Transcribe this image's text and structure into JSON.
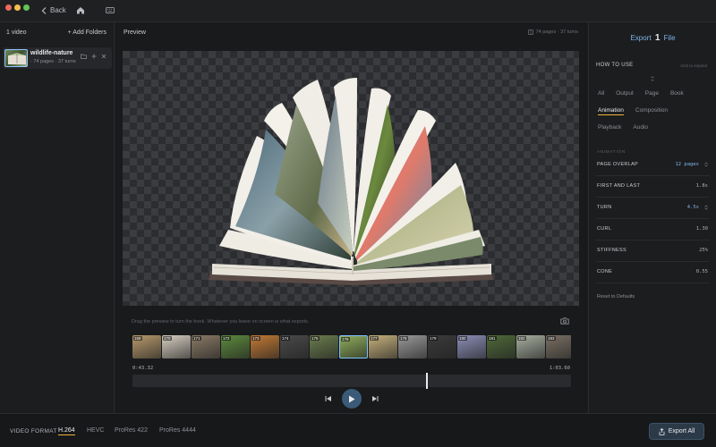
{
  "toolbar": {
    "back_label": "Back"
  },
  "sidebar": {
    "count_label": "1 video",
    "add_folders_label": "+ Add Folders",
    "videos": [
      {
        "name": "wildlife-nature",
        "meta": "· 74 pages · 37 turns"
      }
    ]
  },
  "preview": {
    "label": "Preview",
    "meta": "74 pages · 37 turns",
    "hint": "Drag the preview to turn the book. Whatever you leave on screen is what exports.",
    "start_time": "0:43.32",
    "end_time": "1:03.60",
    "playhead_fraction": 0.67,
    "frames": [
      {
        "num": "169",
        "color": "#b79a6c"
      },
      {
        "num": "170",
        "color": "#d7cfc2"
      },
      {
        "num": "171",
        "color": "#8a7a66"
      },
      {
        "num": "172",
        "color": "#5d8a3e"
      },
      {
        "num": "173",
        "color": "#c27a36"
      },
      {
        "num": "174",
        "color": "#4a4a4a"
      },
      {
        "num": "175",
        "color": "#6b7d4e"
      },
      {
        "num": "176",
        "color": "#8fae5c"
      },
      {
        "num": "177",
        "color": "#c7b27e"
      },
      {
        "num": "178",
        "color": "#9a9a9a"
      },
      {
        "num": "179",
        "color": "#3b3b3b"
      },
      {
        "num": "180",
        "color": "#8d8fb7"
      },
      {
        "num": "181",
        "color": "#4f6a3a"
      },
      {
        "num": "182",
        "color": "#a8b0a0"
      },
      {
        "num": "183",
        "color": "#7a7064"
      }
    ],
    "selected_frame_index": 7
  },
  "export": {
    "prefix": "Export",
    "count": "1",
    "suffix": "File",
    "how_to_use": "HOW TO USE",
    "click_to_expand": "click to expand",
    "tabs_row1": [
      "All",
      "Output",
      "Page",
      "Book"
    ],
    "tabs_row2": [
      "Animation",
      "Composition"
    ],
    "tabs_row3": [
      "Playback",
      "Audio"
    ],
    "active_tab": "Animation",
    "section_label": "ANIMATION",
    "params": [
      {
        "label": "PAGE OVERLAP",
        "value": "12 pages",
        "accent": true
      },
      {
        "label": "FIRST AND LAST",
        "value": "1.8s",
        "accent": false
      },
      {
        "label": "TURN",
        "value": "4.5s",
        "accent": true
      },
      {
        "label": "CURL",
        "value": "1.30",
        "accent": false
      },
      {
        "label": "STIFFNESS",
        "value": "25%",
        "accent": false
      },
      {
        "label": "CONE",
        "value": "0.55",
        "accent": false
      }
    ],
    "reset_label": "Reset to Defaults"
  },
  "bottom": {
    "video_format_label": "VIDEO FORMAT",
    "formats": [
      "H.264",
      "HEVC",
      "ProRes 422",
      "ProRes 4444"
    ],
    "active_format": "H.264",
    "export_all_label": "Export All"
  },
  "colors": {
    "accent": "#7fb6ea",
    "tab_underline": "#f0b33a"
  }
}
